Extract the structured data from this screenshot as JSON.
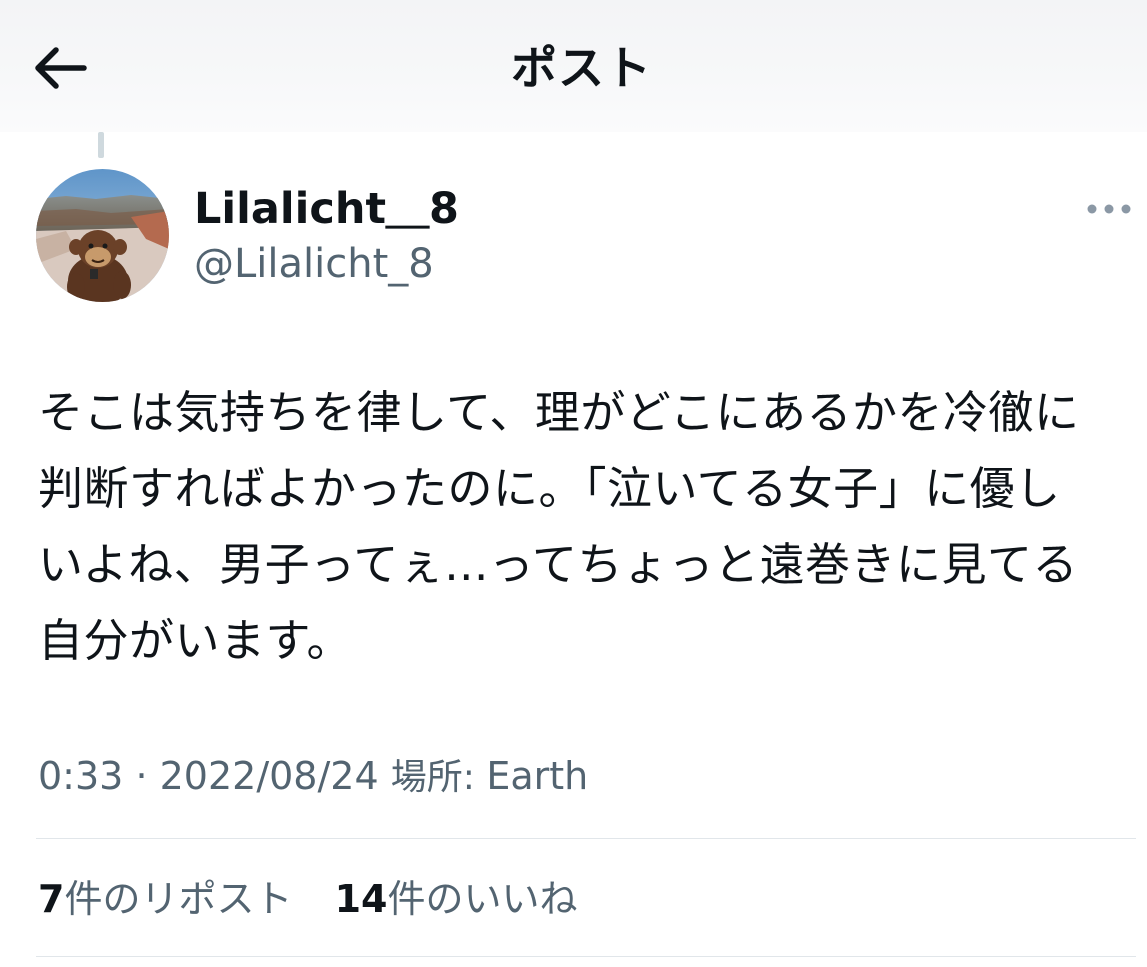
{
  "header": {
    "title": "ポスト",
    "back_icon": "arrow-left-icon"
  },
  "author": {
    "display_name": "Lilalicht＿8",
    "handle": "@Lilalicht_8",
    "more_icon": "more-horizontal-icon"
  },
  "tweet": {
    "lines": [
      "そこは気持ちを律して、理がどこにあるかを冷徹に",
      "判断すればよかったのに。「泣いてる女子」に優し",
      "いよね、男子ってぇ...ってちょっと遠巻きに見てる",
      "自分がいます。"
    ]
  },
  "meta": {
    "time": "0:33",
    "separator": "·",
    "date": "2022/08/24",
    "location_label": "場所: ",
    "location": "Earth"
  },
  "stats": {
    "reposts_count": "7",
    "reposts_label": "件のリポスト",
    "likes_count": "14",
    "likes_label": "件のいいね"
  },
  "colors": {
    "text_primary": "#0f1419",
    "text_secondary": "#536471",
    "divider": "#e1e6ea",
    "thread_line": "#cfd9de"
  }
}
